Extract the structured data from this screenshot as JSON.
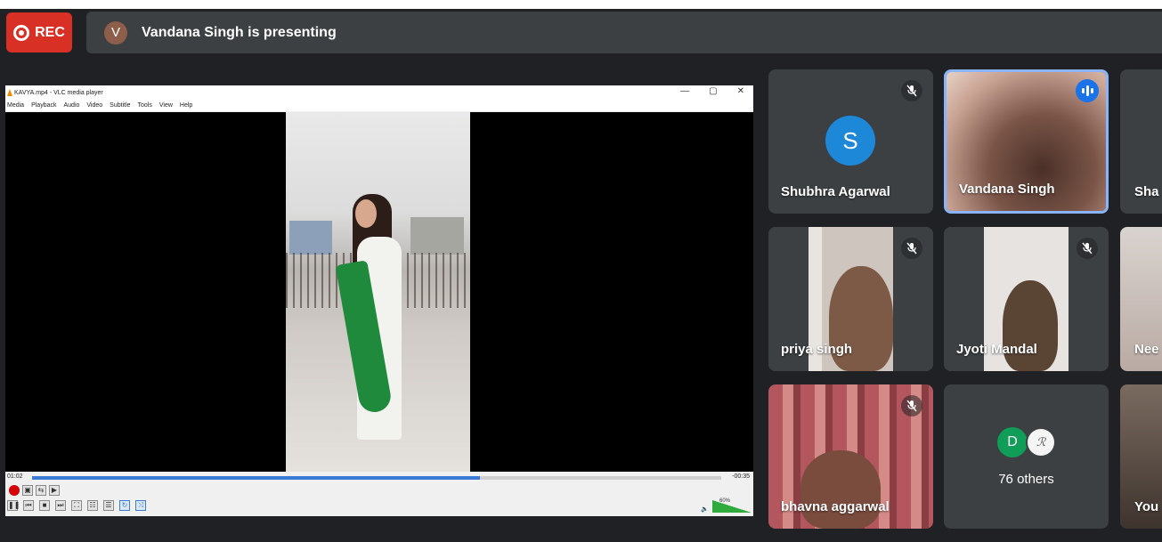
{
  "topbar": {
    "rec_label": "REC",
    "presenter_initial": "V",
    "presenting_text": "Vandana Singh is presenting"
  },
  "vlc": {
    "title": "KAVYA.mp4 - VLC media player",
    "window_buttons": [
      "—",
      "▢",
      "✕"
    ],
    "menu": [
      "Media",
      "Playback",
      "Audio",
      "Video",
      "Subtitle",
      "Tools",
      "View",
      "Help"
    ],
    "time_elapsed": "01:02",
    "time_remaining": "-00:35",
    "progress_fraction": 0.65,
    "volume_percent": "60%"
  },
  "tiles": [
    {
      "name": "Shubhra Agarwal",
      "initial": "S",
      "muted": true
    },
    {
      "name": "Vandana Singh",
      "speaking": true
    },
    {
      "name": "Sha"
    },
    {
      "name": "priya singh",
      "muted": true
    },
    {
      "name": "Jyoti Mandal",
      "muted": true
    },
    {
      "name": "Nee"
    },
    {
      "name": "bhavna aggarwal",
      "muted": true
    },
    {
      "name": "76 others",
      "initial": "D"
    },
    {
      "name": "You"
    }
  ],
  "colors": {
    "rec": "#d93025",
    "bar": "#3c4043",
    "background": "#202124",
    "speaking_border": "#8ab4f8",
    "avatar_s": "#1e88d8"
  },
  "icons": {
    "mic_off": "mic-off-icon",
    "speaking": "audio-wave-icon"
  }
}
